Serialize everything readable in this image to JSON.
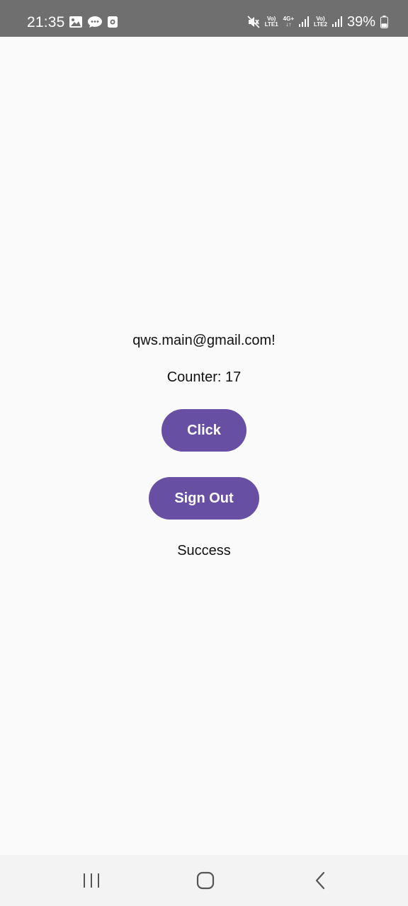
{
  "status_bar": {
    "time": "21:35",
    "left_icons": [
      "gallery-icon",
      "chat-icon",
      "screen-record-icon"
    ],
    "network_sim1_top": "Vo)",
    "network_sim1_bottom": "LTE1",
    "network_type_label": "4G+",
    "network_sim2_top": "Vo)",
    "network_sim2_bottom": "LTE2",
    "battery_percent": "39%",
    "battery_level": 0.39
  },
  "main": {
    "email": "qws.main@gmail.com!",
    "counter": "Counter: 17",
    "click_label": "Click",
    "signout_label": "Sign Out",
    "status_message": "Success"
  },
  "colors": {
    "accent": "#6750a4",
    "background": "#fafafa",
    "status_bar": "#6f6f6f"
  },
  "navigation": {
    "buttons": [
      "recents-icon",
      "home-icon",
      "back-icon"
    ]
  }
}
